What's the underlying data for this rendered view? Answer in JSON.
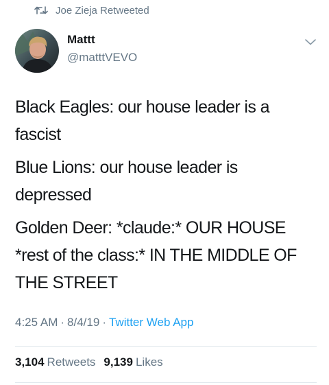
{
  "retweet_banner": {
    "icon": "retweet-icon",
    "text": "Joe Zieja Retweeted"
  },
  "author": {
    "name": "Mattt",
    "handle": "@matttVEVO",
    "avatar_icon": "avatar-photo"
  },
  "tweet": {
    "lines": [
      "Black Eagles: our house leader is a fascist",
      "Blue Lions: our house leader is depressed",
      "Golden Deer: *claude:* OUR HOUSE *rest of the class:* IN THE MIDDLE OF THE STREET"
    ]
  },
  "meta": {
    "time": "4:25 AM",
    "separator": "·",
    "date": "8/4/19",
    "source": "Twitter Web App"
  },
  "stats": {
    "retweets_count": "3,104",
    "retweets_label": "Retweets",
    "likes_count": "9,139",
    "likes_label": "Likes"
  },
  "colors": {
    "text": "#14171a",
    "secondary": "#657786",
    "link": "#1da1f2",
    "divider": "#e1e8ed"
  }
}
